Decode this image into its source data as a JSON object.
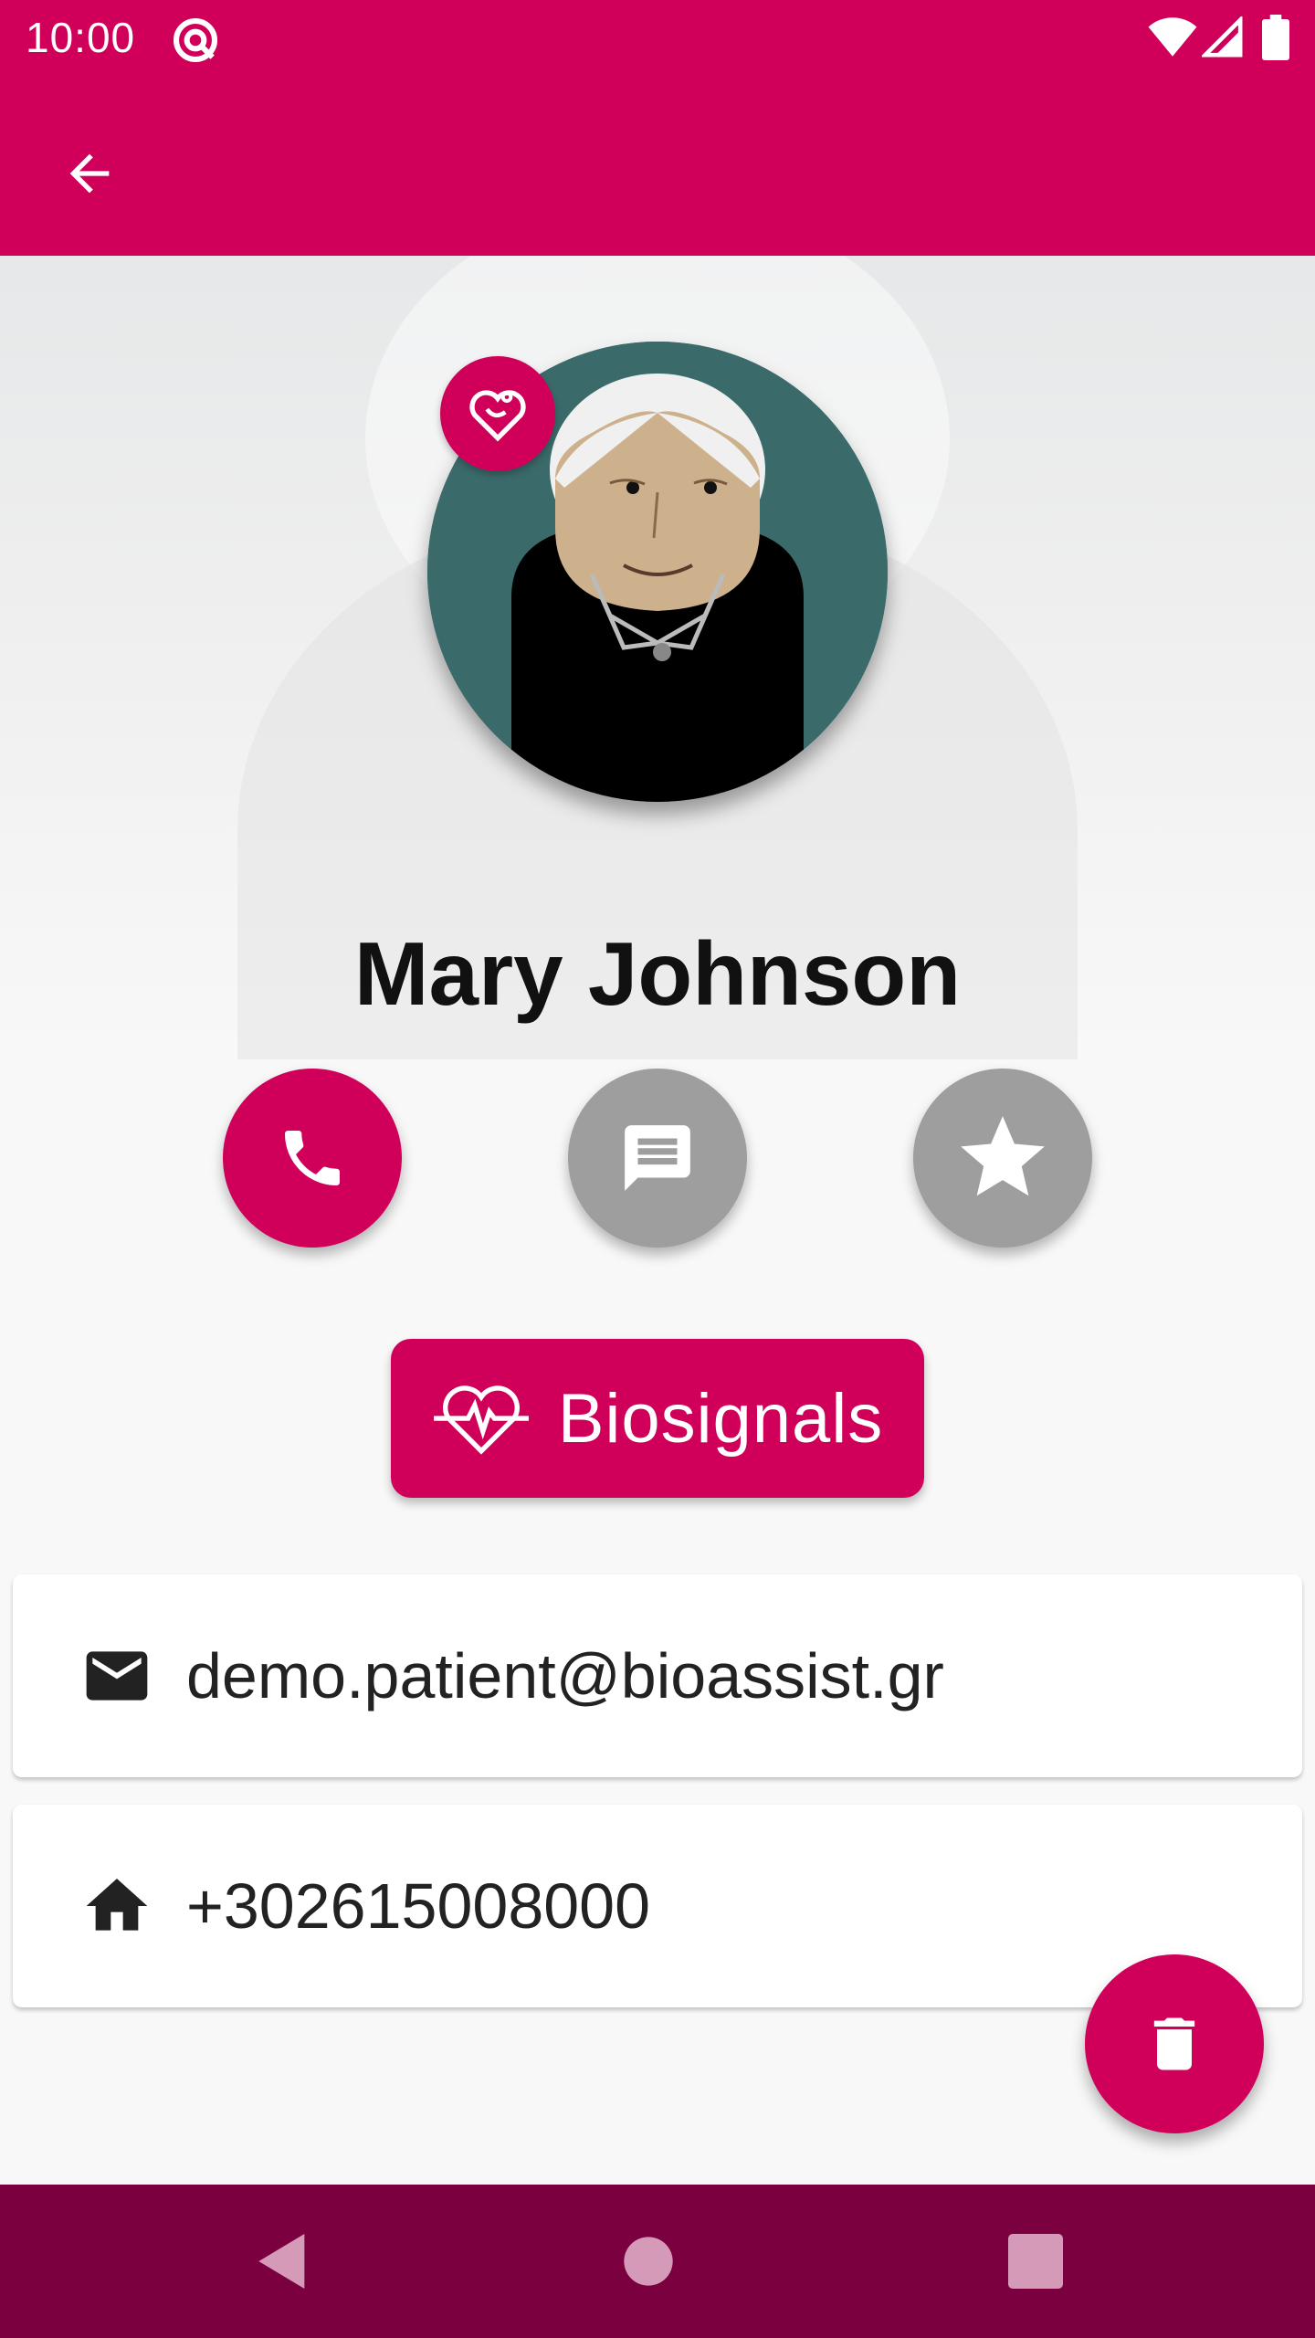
{
  "status_bar": {
    "time": "10:00",
    "icons": [
      "at-sign-icon",
      "wifi-icon",
      "signal-icon",
      "battery-icon"
    ]
  },
  "app_bar": {
    "back_icon": "arrow-left-icon"
  },
  "profile": {
    "name": "Mary Johnson",
    "badge_icon": "heart-stethoscope-icon",
    "avatar": "elderly-woman-avatar"
  },
  "actions": {
    "call_icon": "phone-icon",
    "message_icon": "chat-icon",
    "favorite_icon": "star-icon"
  },
  "biosignals": {
    "label": "Biosignals",
    "icon": "heartbeat-icon"
  },
  "contact": {
    "email": "demo.patient@bioassist.gr",
    "email_icon": "mail-icon",
    "phone": "+302615008000",
    "phone_icon": "home-icon"
  },
  "fab": {
    "icon": "trash-icon"
  },
  "colors": {
    "primary": "#d0005a",
    "nav_bar": "#7a0040",
    "inactive_action": "#9e9e9e",
    "background": "#f8f8f8"
  }
}
